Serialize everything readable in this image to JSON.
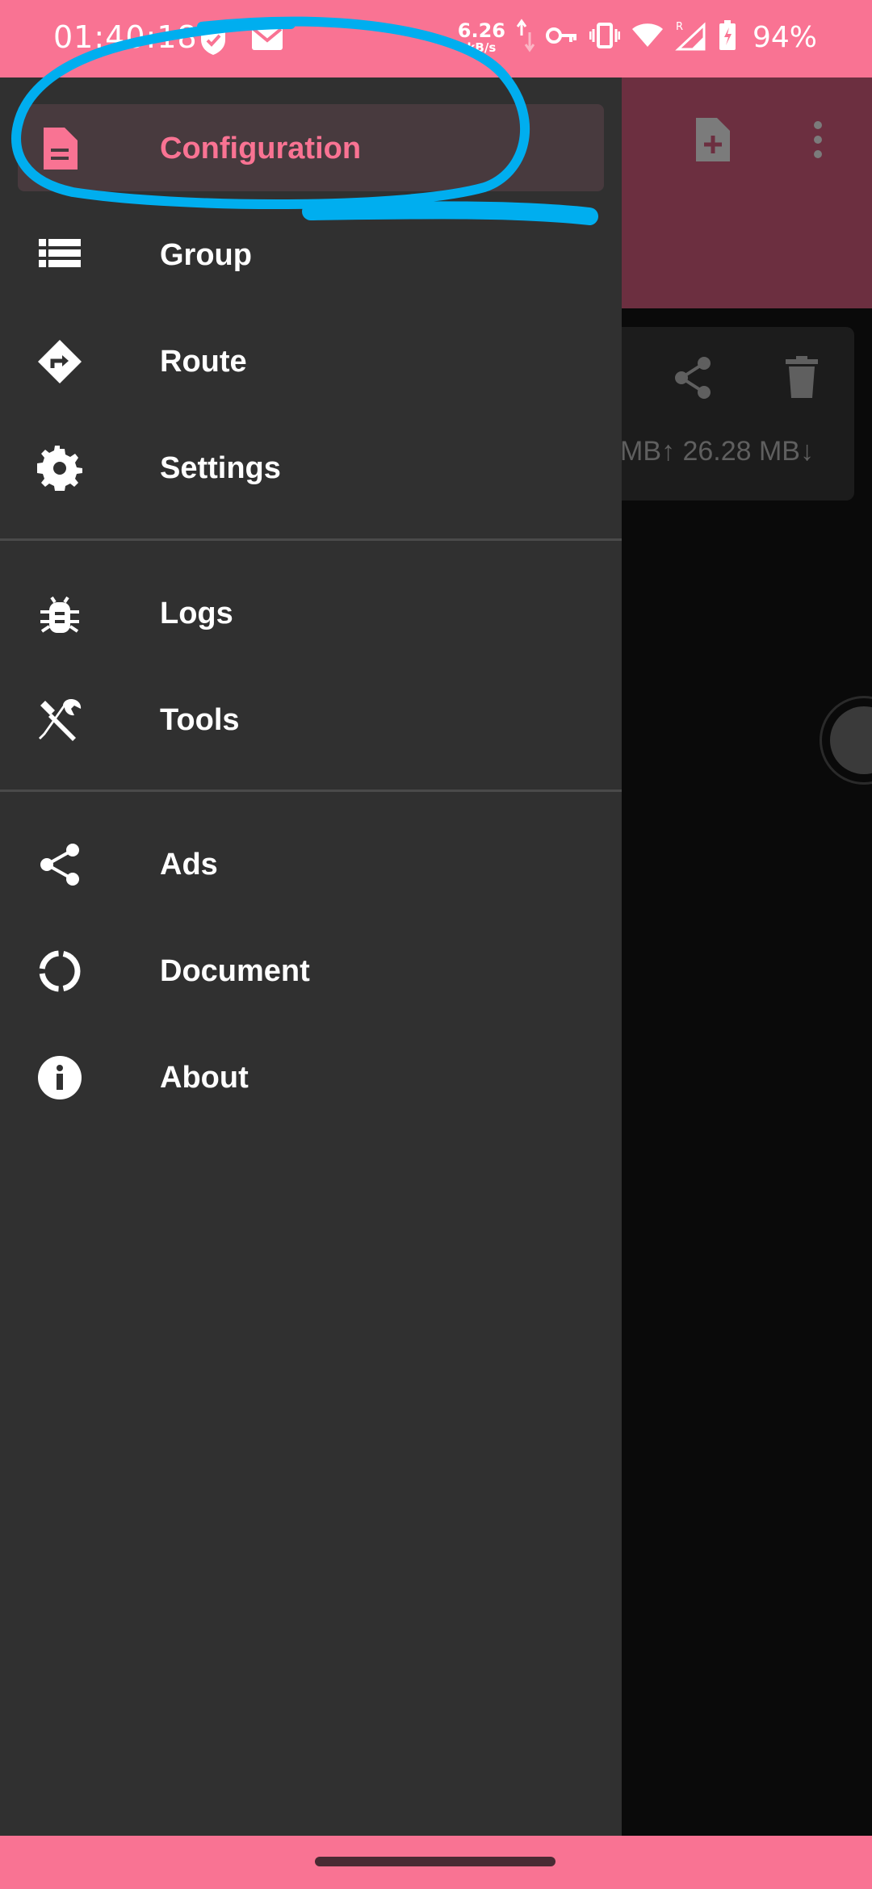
{
  "status_bar": {
    "time": "01:40:18",
    "net_speed_value": "6.26",
    "net_speed_unit": "kB/s",
    "battery": "94%",
    "icons": [
      "shield-icon",
      "mail-icon",
      "upload-download-arrows-icon",
      "vpn-key-icon",
      "vibrate-icon",
      "wifi-icon",
      "signal-roaming-icon",
      "battery-charging-icon"
    ]
  },
  "background_app": {
    "traffic_text": "MB↑ 26.28 MB↓",
    "icons": [
      "add-file-icon",
      "more-vert-icon",
      "share-icon",
      "delete-icon",
      "connect-fab-icon"
    ]
  },
  "drawer": {
    "items": [
      {
        "label": "Configuration",
        "icon": "description-icon",
        "selected": true
      },
      {
        "label": "Group",
        "icon": "list-icon"
      },
      {
        "label": "Route",
        "icon": "directions-icon"
      },
      {
        "label": "Settings",
        "icon": "gear-icon"
      },
      {
        "label": "Logs",
        "icon": "bug-icon"
      },
      {
        "label": "Tools",
        "icon": "tools-icon"
      },
      {
        "label": "Ads",
        "icon": "share-icon"
      },
      {
        "label": "Document",
        "icon": "progress-circle-icon"
      },
      {
        "label": "About",
        "icon": "info-icon"
      }
    ]
  },
  "colors": {
    "accent": "#f97393",
    "drawer_bg": "#303030",
    "annotation": "#00aeef"
  }
}
